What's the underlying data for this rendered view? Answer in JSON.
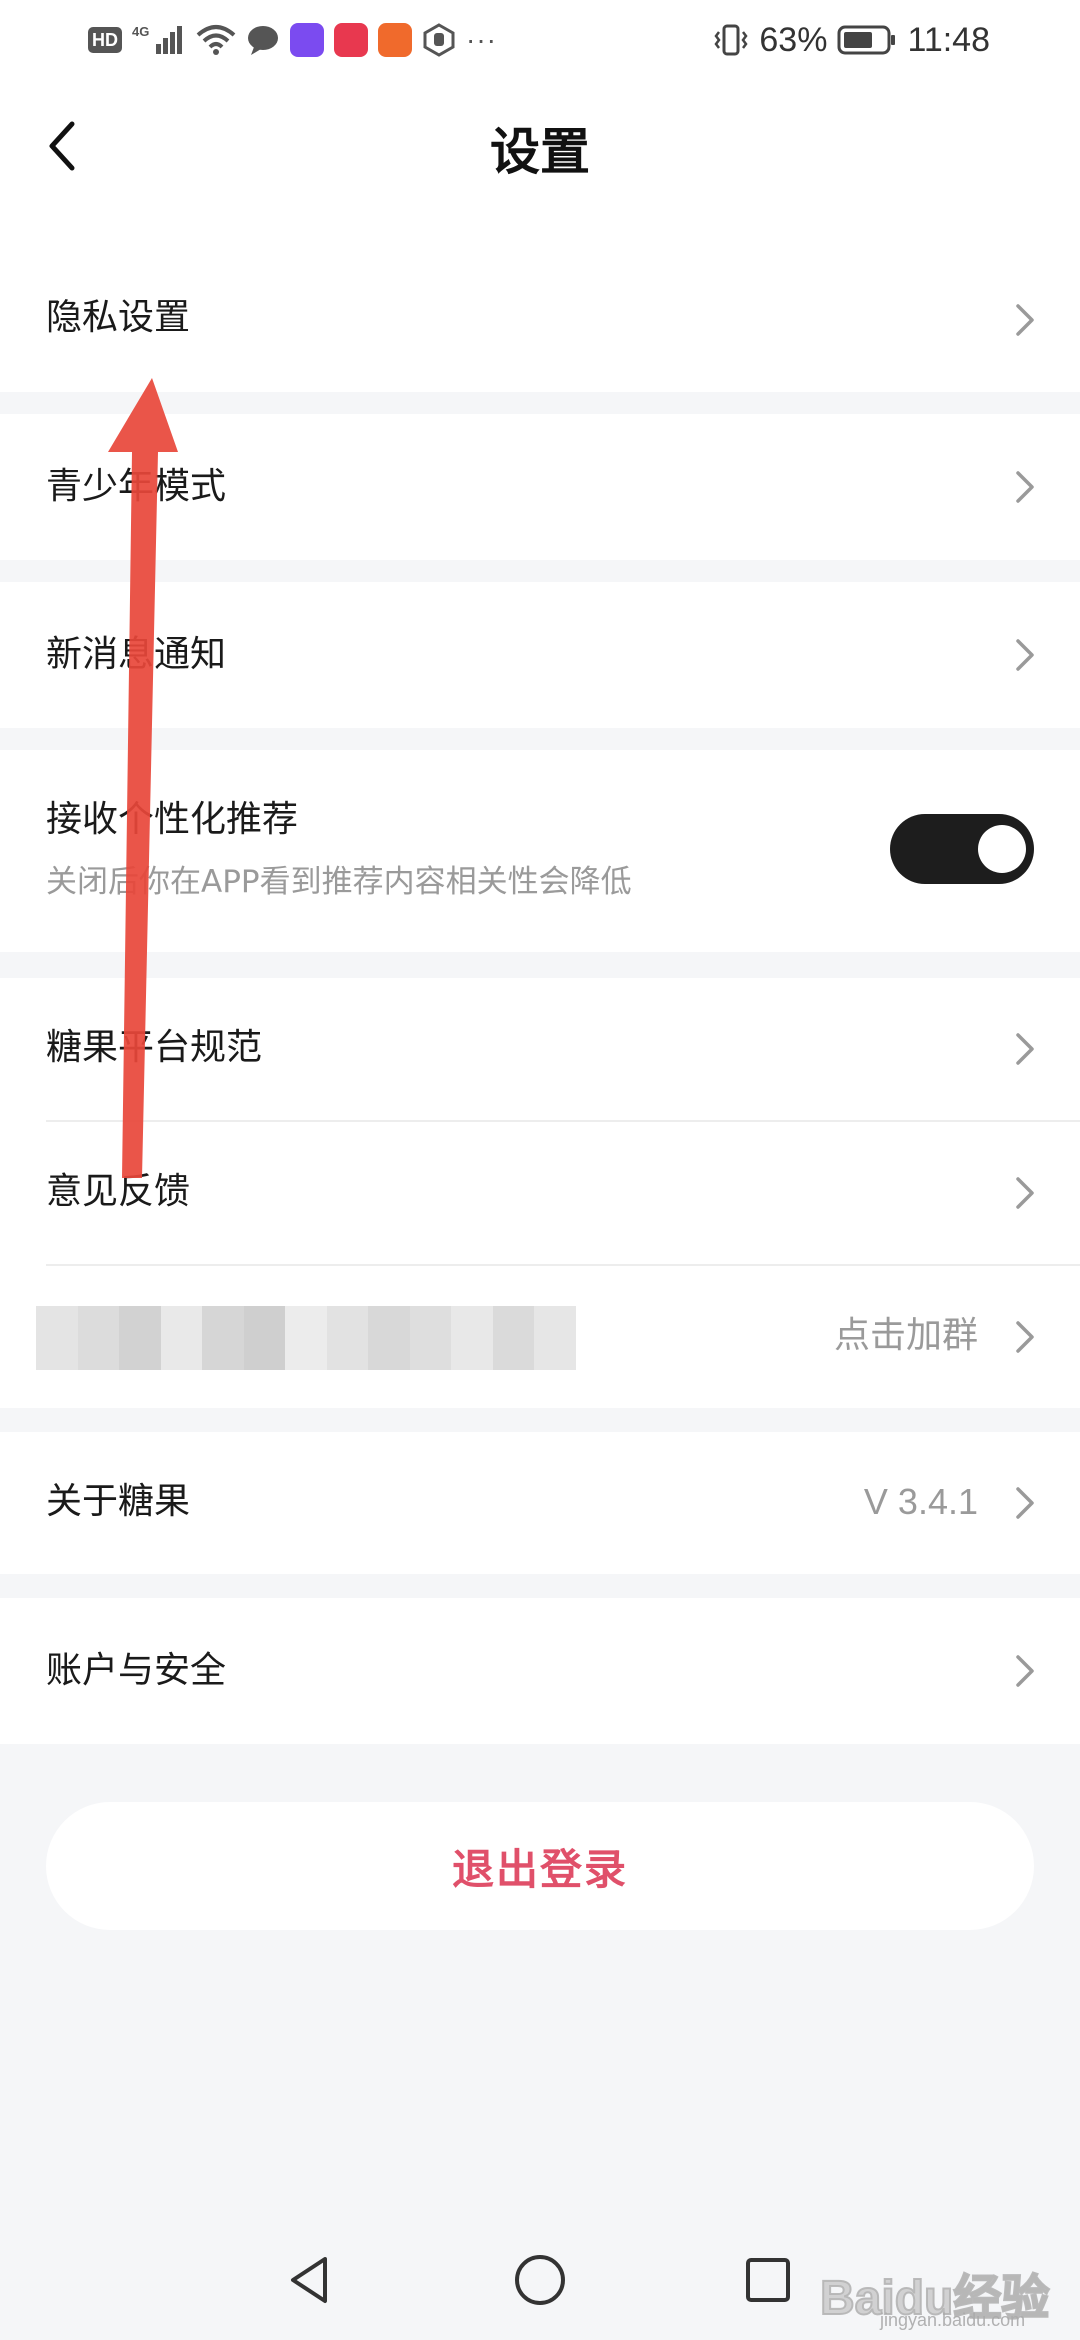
{
  "status_bar": {
    "hd": "HD",
    "network": "4G",
    "more": "···",
    "battery_percent": "63%",
    "time": "11:48",
    "app_icon_colors": [
      "#7b4bf0",
      "#e8384f",
      "#f06a2c"
    ]
  },
  "header": {
    "title": "设置",
    "back_icon": "chevron-left-icon"
  },
  "rows": [
    {
      "label": "隐私设置"
    },
    {
      "label": "青少年模式"
    },
    {
      "label": "新消息通知"
    },
    {
      "label": "接收个性化推荐",
      "sub": "关闭后你在APP看到推荐内容相关性会降低",
      "toggle_on": true
    },
    {
      "label": "糖果平台规范"
    },
    {
      "label": "意见反馈"
    },
    {
      "label": "",
      "value": "点击加群"
    },
    {
      "label": "关于糖果",
      "value": "V 3.4.1"
    },
    {
      "label": "账户与安全"
    }
  ],
  "logout": {
    "label": "退出登录",
    "color": "#e0506a"
  },
  "nav": {
    "icons": [
      "back-triangle-icon",
      "home-circle-icon",
      "recents-square-icon"
    ]
  },
  "watermark": {
    "text": "Baidu经验",
    "sub": "jingyan.baidu.com"
  },
  "colors": {
    "accent": "#e0506a",
    "annotation_arrow": "#e8463a",
    "toggle_track": "#1d1d1d"
  }
}
